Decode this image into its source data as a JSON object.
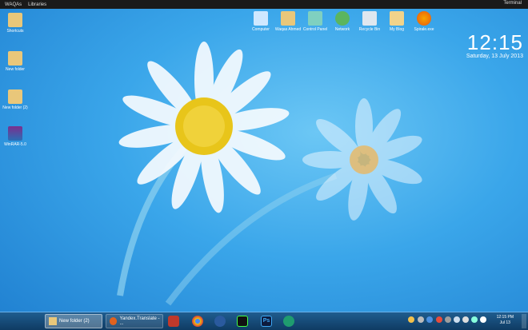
{
  "topbar": {
    "menu": [
      {
        "label": "WAQAs"
      },
      {
        "label": "Libraries"
      }
    ],
    "right_label": "Terminal"
  },
  "desktop": {
    "left_icons": [
      {
        "label": "Shortcuts"
      },
      {
        "label": "New folder"
      },
      {
        "label": "New folder (2)"
      },
      {
        "label": "WinRAR-5.0"
      }
    ],
    "top_icons": [
      {
        "label": "Computer"
      },
      {
        "label": "Waqas Ahmed"
      },
      {
        "label": "Control Panel"
      },
      {
        "label": "Network"
      },
      {
        "label": "Recycle Bin"
      },
      {
        "label": "My Blog"
      },
      {
        "label": "Spirale.exe"
      }
    ],
    "clock": {
      "time": "12:15",
      "date": "Saturday, 13 July 2013"
    }
  },
  "taskbar": {
    "buttons": [
      {
        "label": "New folder (2)"
      },
      {
        "label": "Yandex.Translate - ..."
      }
    ],
    "pinned": [
      {
        "name": "books-icon"
      },
      {
        "name": "chrome-icon"
      },
      {
        "name": "thunderbird-icon"
      },
      {
        "name": "terminal-icon"
      },
      {
        "name": "photoshop-icon",
        "label": "Ps"
      },
      {
        "name": "messenger-icon"
      }
    ],
    "clock": {
      "time": "12:15 PM",
      "date": "Jul 13"
    }
  }
}
